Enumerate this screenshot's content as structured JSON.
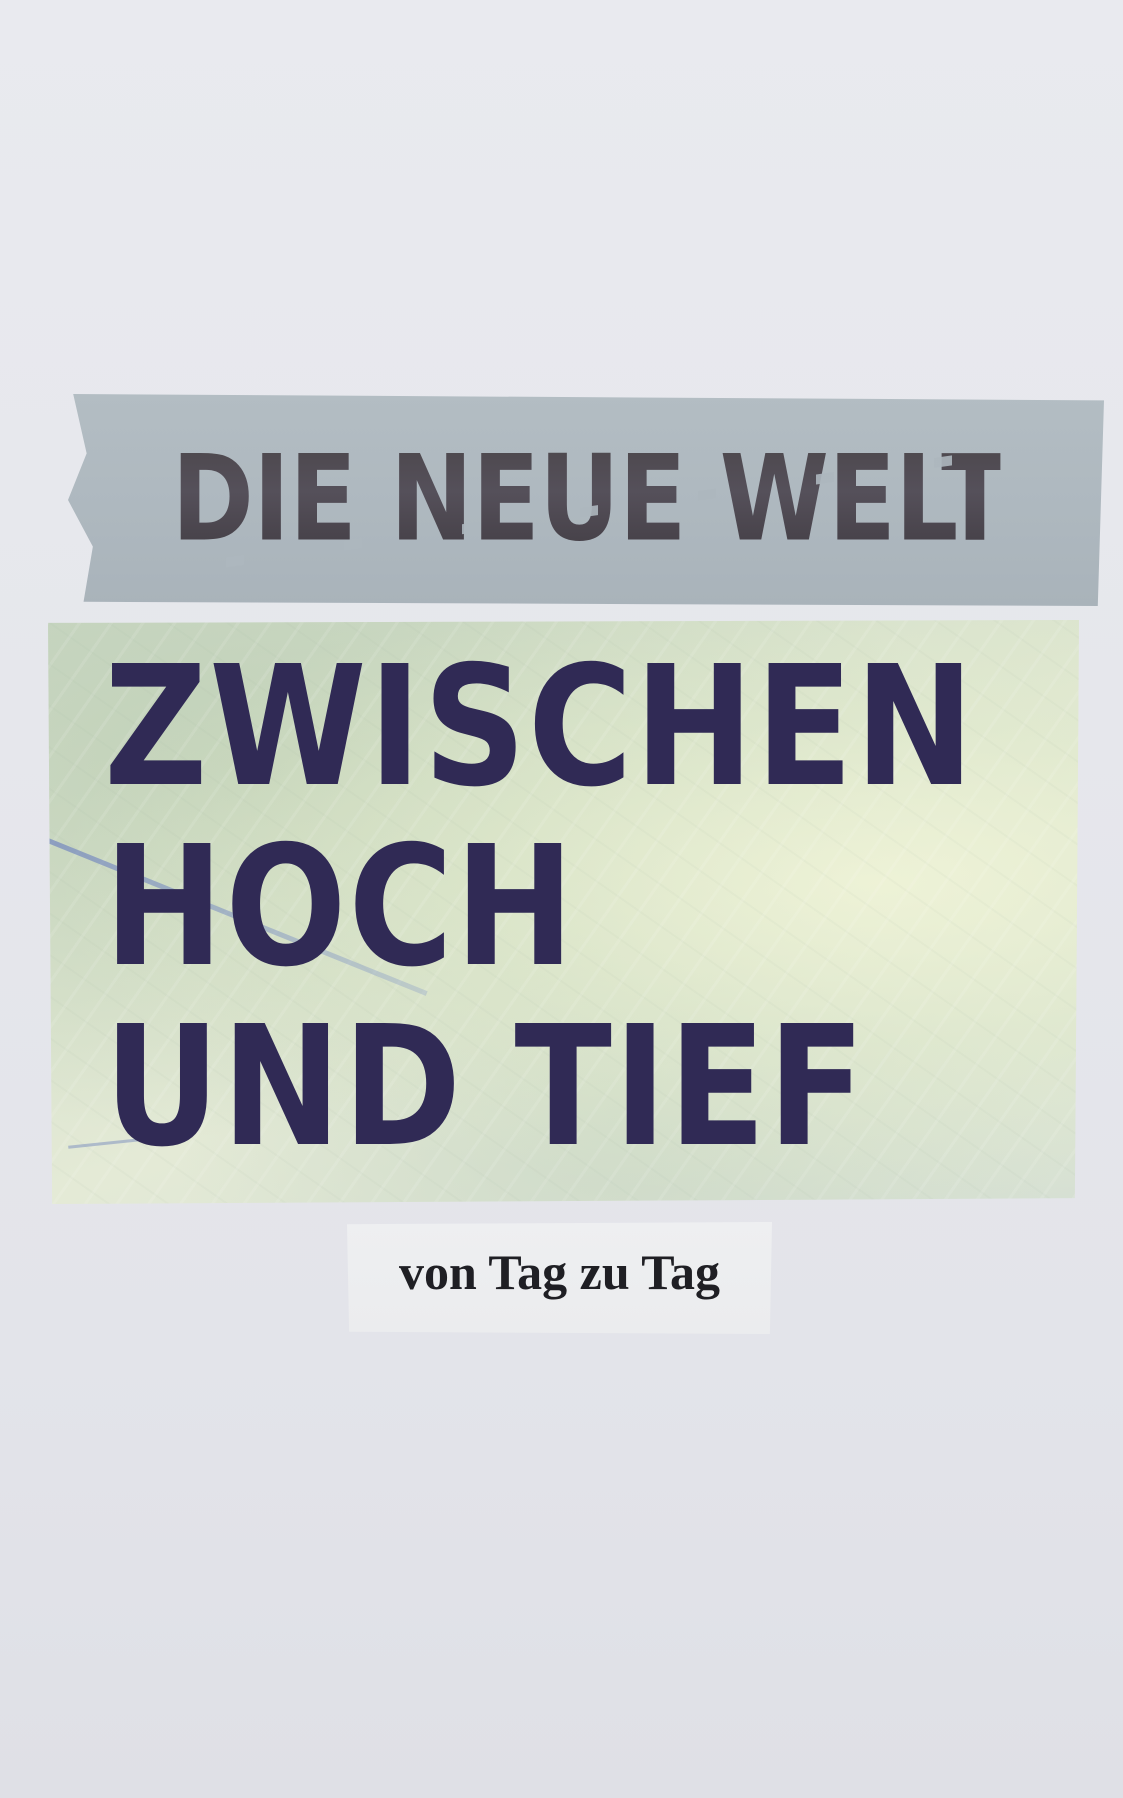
{
  "collage": {
    "stencil_title": "DIE NEUE WELT",
    "headline_lines": [
      "ZWISCHEN",
      "HOCH",
      "UND TIEF"
    ],
    "subtitle": "von Tag zu Tag"
  },
  "colors": {
    "background": "#e6e7ec",
    "stencil_strip": "#aeb8bf",
    "stencil_ink": "#4a4549",
    "headline_ink": "#302a55",
    "photo_green": "#dbe4cf",
    "subtitle_ink": "#1f1f24"
  }
}
